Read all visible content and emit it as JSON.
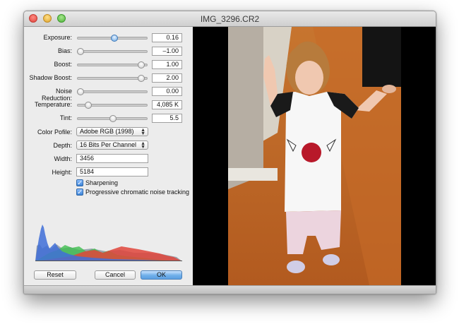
{
  "window": {
    "title": "IMG_3296.CR2"
  },
  "adjustments": [
    {
      "label": "Exposure:",
      "value": "0.16",
      "level": 0.53,
      "active": true
    },
    {
      "label": "Bias:",
      "value": "–1.00",
      "level": 0.0,
      "active": false
    },
    {
      "label": "Boost:",
      "value": "1.00",
      "level": 0.96,
      "active": false
    },
    {
      "label": "Shadow Boost:",
      "value": "2.00",
      "level": 0.96,
      "active": false
    },
    {
      "label": "Noise Reduction:",
      "value": "0.00",
      "level": 0.0,
      "active": false
    },
    {
      "label": "Temperature:",
      "value": "4,085 K",
      "level": 0.12,
      "active": false
    },
    {
      "label": "Tint:",
      "value": "5.5",
      "level": 0.51,
      "active": false
    }
  ],
  "color_profile": {
    "label": "Color Pofile:",
    "value": "Adobe RGB (1998)"
  },
  "depth": {
    "label": "Depth:",
    "value": "16 Bits Per Channel"
  },
  "width": {
    "label": "Width:",
    "value": "3456"
  },
  "height": {
    "label": "Height:",
    "value": "5184"
  },
  "options": {
    "sharpening": {
      "label": "Sharpening",
      "checked": true
    },
    "chromatic": {
      "label": "Progressive chromatic noise tracking",
      "checked": true
    }
  },
  "buttons": {
    "reset": "Reset",
    "cancel": "Cancel",
    "ok": "OK"
  },
  "histogram_colors": {
    "blue": "#3f6fd8",
    "green": "#3fbf4f",
    "red": "#e0453b",
    "gray": "#7f8c99"
  }
}
